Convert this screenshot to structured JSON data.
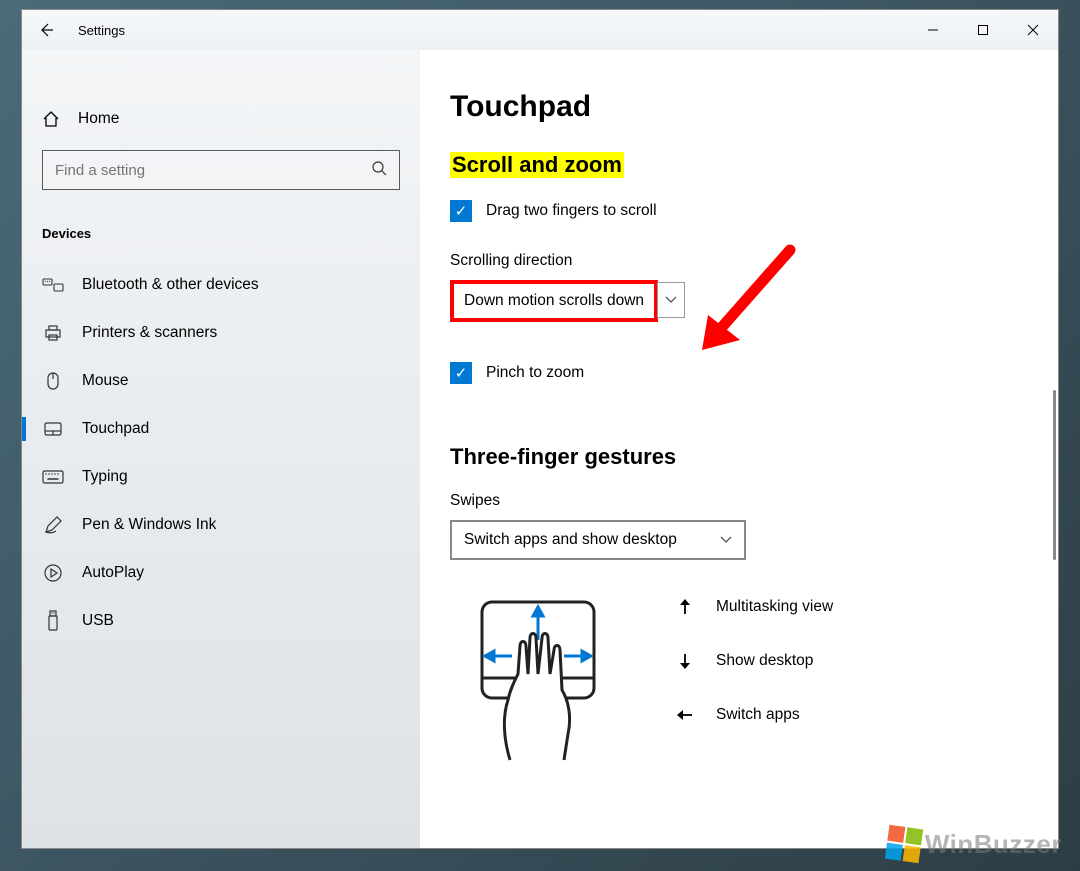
{
  "app_title": "Settings",
  "home_label": "Home",
  "search_placeholder": "Find a setting",
  "category_header": "Devices",
  "nav": [
    {
      "label": "Bluetooth & other devices"
    },
    {
      "label": "Printers & scanners"
    },
    {
      "label": "Mouse"
    },
    {
      "label": "Touchpad",
      "active": true
    },
    {
      "label": "Typing"
    },
    {
      "label": "Pen & Windows Ink"
    },
    {
      "label": "AutoPlay"
    },
    {
      "label": "USB"
    }
  ],
  "page": {
    "title": "Touchpad",
    "section_scroll": "Scroll and zoom",
    "cb_drag": "Drag two fingers to scroll",
    "direction_label": "Scrolling direction",
    "direction_value": "Down motion scrolls down",
    "cb_pinch": "Pinch to zoom",
    "section_three": "Three-finger gestures",
    "swipes_label": "Swipes",
    "swipes_value": "Switch apps and show desktop",
    "gestures": {
      "up": "Multitasking view",
      "down": "Show desktop",
      "left": "Switch apps"
    }
  },
  "watermark": "WinBuzzer"
}
